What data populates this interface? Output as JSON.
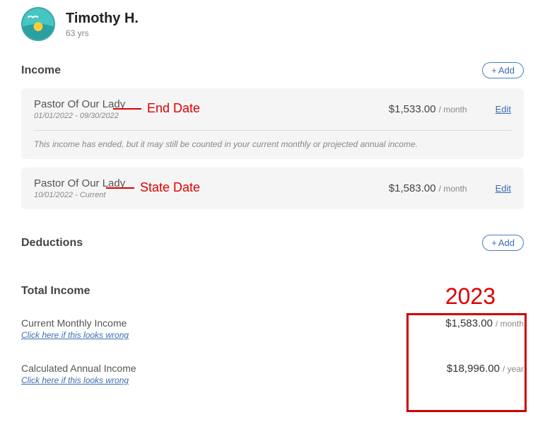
{
  "person": {
    "name": "Timothy H.",
    "age": "63 yrs"
  },
  "income": {
    "section_label": "Income",
    "add_label": "Add",
    "items": [
      {
        "name": "Pastor Of Our Lady",
        "dates": "01/01/2022 - 09/30/2022",
        "amount": "$1,533.00",
        "period": "/ month",
        "edit": "Edit",
        "ended_note": "This income has ended, but it may still be counted in your current monthly or projected annual income."
      },
      {
        "name": "Pastor Of Our Lady",
        "dates": "10/01/2022 - Current",
        "amount": "$1,583.00",
        "period": "/ month",
        "edit": "Edit"
      }
    ]
  },
  "deductions": {
    "section_label": "Deductions",
    "add_label": "Add"
  },
  "total": {
    "section_label": "Total Income",
    "rows": [
      {
        "label": "Current Monthly Income",
        "wrong": "Click here if this looks wrong",
        "amount": "$1,583.00",
        "period": "/ month"
      },
      {
        "label": "Calculated Annual Income",
        "wrong": "Click here if this looks wrong",
        "amount": "$18,996.00",
        "period": "/ year"
      }
    ]
  },
  "annotations": {
    "end_date": "End Date",
    "start_date": "State Date",
    "year": "2023"
  }
}
